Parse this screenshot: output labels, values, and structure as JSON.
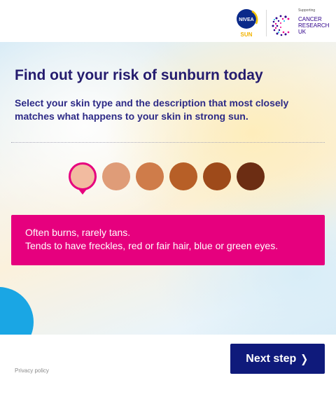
{
  "header": {
    "nivea_logo": {
      "top_text": "NIVEA",
      "bottom_text": "SUN",
      "icon": "nivea-sun-logo-icon"
    },
    "cruk_logo": {
      "supporting_text": "Supporting",
      "lines": [
        "CANCER",
        "RESEARCH",
        "UK"
      ],
      "icon": "cancer-research-uk-logo-icon"
    }
  },
  "main": {
    "title": "Find out your risk of sunburn today",
    "subtitle": "Select your skin type and the description that most closely matches what happens to your skin in strong sun.",
    "skin_tones": [
      {
        "color": "#f2bba0",
        "selected": true
      },
      {
        "color": "#df9c78",
        "selected": false
      },
      {
        "color": "#cf7c4a",
        "selected": false
      },
      {
        "color": "#b75f27",
        "selected": false
      },
      {
        "color": "#9e4a1a",
        "selected": false
      },
      {
        "color": "#6c2d13",
        "selected": false
      }
    ],
    "description": {
      "line1": "Often burns, rarely tans.",
      "line2": "Tends to have freckles, red or fair hair, blue or green eyes."
    }
  },
  "footer": {
    "privacy_label": "Privacy policy",
    "next_label": "Next step",
    "next_icon": "chevron-right-icon"
  },
  "colors": {
    "accent_pink": "#e6007e",
    "brand_navy": "#0f1a7b",
    "title_navy": "#241b6e",
    "sky_blue": "#1aa6e4"
  }
}
